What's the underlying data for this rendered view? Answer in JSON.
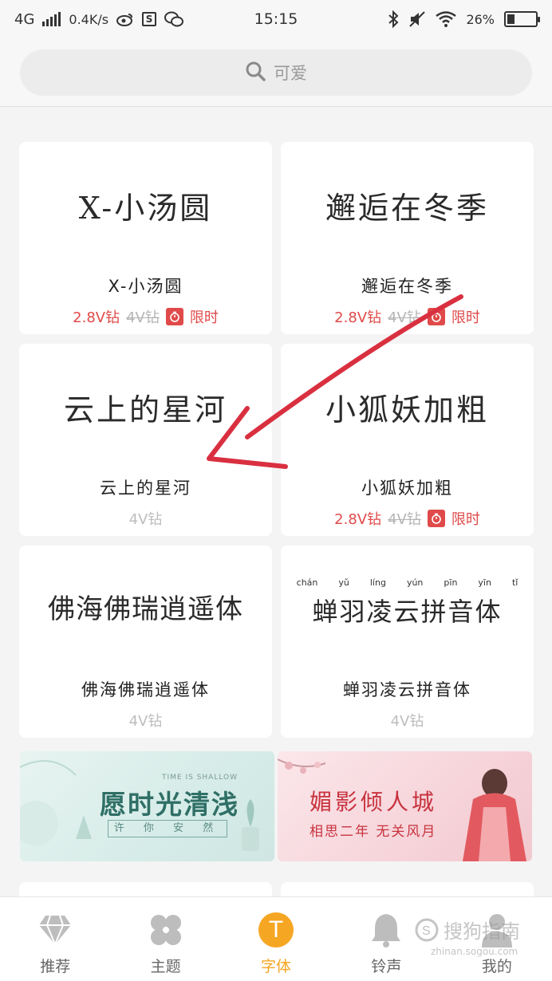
{
  "status_bar": {
    "network": "4G",
    "speed": "0.4K/s",
    "time": "15:15",
    "battery": "26%",
    "battery_level": 0.26,
    "icons": [
      "signal-icon",
      "weibo-icon",
      "s-app-icon",
      "wechat-icon",
      "bluetooth-icon",
      "mute-icon",
      "wifi-icon",
      "battery-icon"
    ]
  },
  "search": {
    "placeholder": "可爱",
    "icon": "search-icon"
  },
  "fonts": [
    {
      "preview": "X-小汤圆",
      "name": "X-小汤圆",
      "price": "2.8V钻",
      "original_price": "4V钻",
      "badge": "限时"
    },
    {
      "preview": "邂逅在冬季",
      "name": "邂逅在冬季",
      "price": "2.8V钻",
      "original_price": "4V钻",
      "badge": "限时"
    },
    {
      "preview": "云上的星河",
      "name": "云上的星河",
      "price": "4V钻"
    },
    {
      "preview": "小狐妖加粗",
      "name": "小狐妖加粗",
      "price": "2.8V钻",
      "original_price": "4V钻",
      "badge": "限时"
    },
    {
      "preview": "佛海佛瑞逍遥体",
      "name": "佛海佛瑞逍遥体",
      "price": "4V钻"
    },
    {
      "preview": "蝉羽凌云拼音体",
      "name": "蝉羽凌云拼音体",
      "price": "4V钻",
      "pinyin": [
        "chán",
        "yǔ",
        "líng",
        "yún",
        "pīn",
        "yīn",
        "tǐ"
      ]
    }
  ],
  "banners": {
    "left": {
      "title": "愿时光清浅",
      "small": "TIME IS SHALLOW",
      "subtitle": "许 你 安 然"
    },
    "right": {
      "title": "媚影倾人城",
      "subtitle": "相思二年 无关风月"
    }
  },
  "bottom_nav": [
    {
      "label": "推荐",
      "icon": "diamond-icon",
      "active": false
    },
    {
      "label": "主题",
      "icon": "theme-icon",
      "active": false
    },
    {
      "label": "字体",
      "icon": "font-t-icon",
      "active": true
    },
    {
      "label": "铃声",
      "icon": "bell-icon",
      "active": false
    },
    {
      "label": "我的",
      "icon": "user-icon",
      "active": false
    }
  ],
  "watermark": {
    "text": "搜狗指南",
    "url": "zhinan.sogou.com"
  },
  "colors": {
    "accent": "#f5a623",
    "sale": "#e04a4a",
    "annotation": "#d93040"
  }
}
